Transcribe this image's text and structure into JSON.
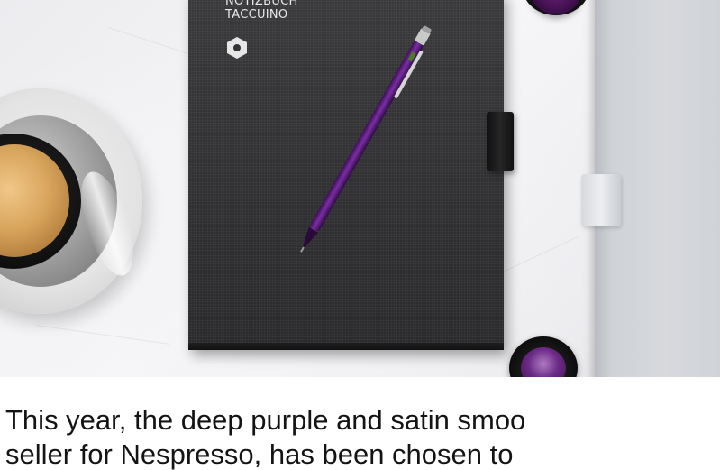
{
  "photo": {
    "notebook_title_line1": "NOTIZBUCH",
    "notebook_title_line2": "TACCUINO",
    "notebook_logo_icon": "hexagon-logo-icon",
    "colors": {
      "pen_purple": "#5b1f7e",
      "notebook": "#333335",
      "box_grey": "#d3d5d9"
    }
  },
  "caption": {
    "line1": "This year, the deep purple and satin smoo",
    "line2": "seller for Nespresso, has been chosen to"
  }
}
